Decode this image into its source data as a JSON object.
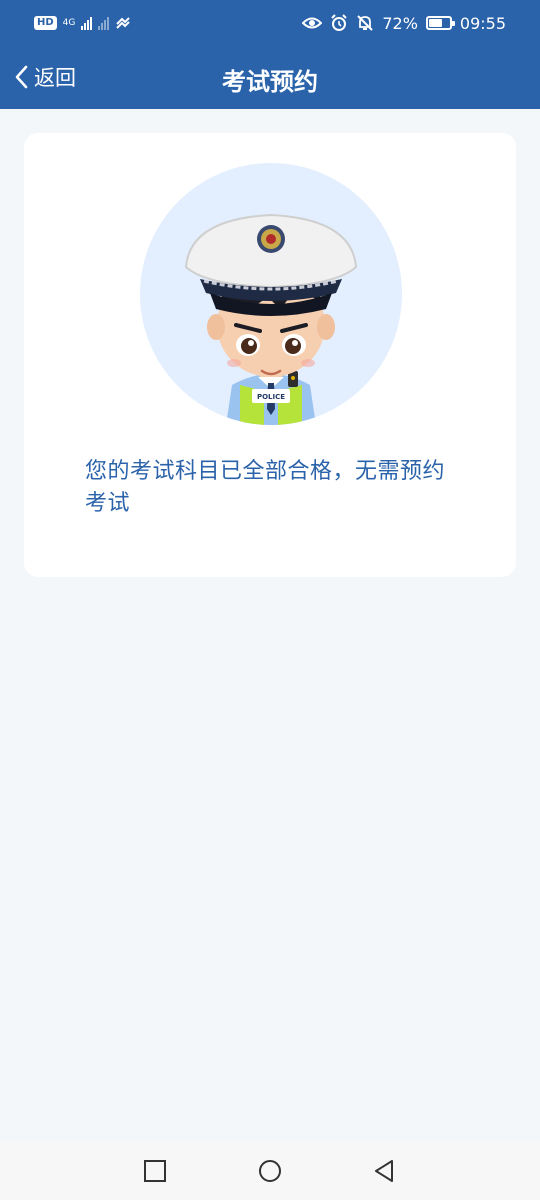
{
  "status_bar": {
    "hd": "HD",
    "net1": "4G",
    "battery_percent_text": "72%",
    "battery_level": 0.72,
    "time": "09:55",
    "icons": [
      "hd-icon",
      "cellular-signal-icon",
      "cellular-signal-icon",
      "data-saver-icon",
      "eye-icon",
      "alarm-icon",
      "bell-muted-icon",
      "battery-icon"
    ]
  },
  "nav": {
    "back_label": "返回",
    "title": "考试预约"
  },
  "card": {
    "avatar": "police-officer-avatar",
    "message": "您的考试科目已全部合格，无需预约考试"
  },
  "system_nav": {
    "icons": [
      "recent-apps-icon",
      "home-icon",
      "back-icon"
    ]
  },
  "colors": {
    "primary": "#2b63ab",
    "background": "#f4f7f9",
    "card": "#ffffff",
    "avatar_bg": "#e3efff",
    "vest": "#b6e33a"
  }
}
